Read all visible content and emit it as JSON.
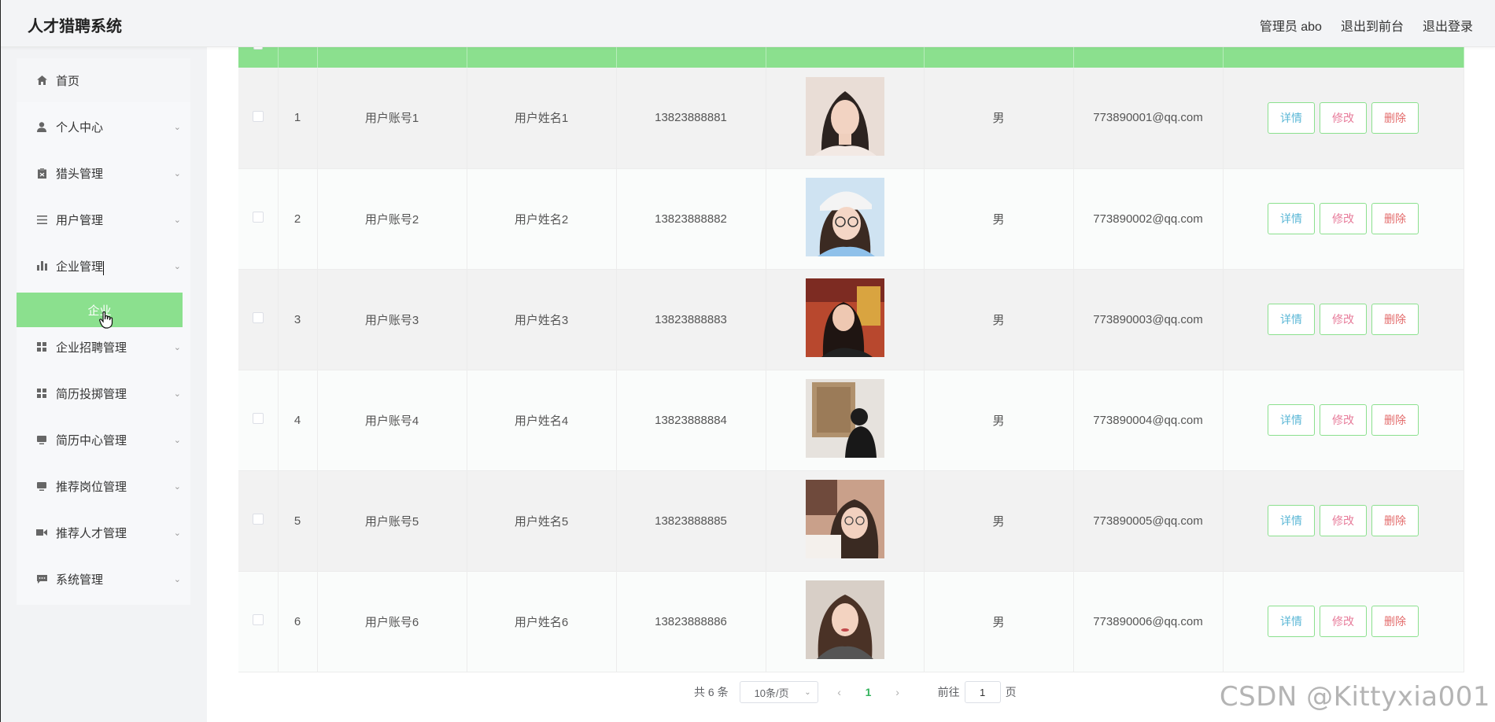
{
  "header": {
    "title": "人才猎聘系统",
    "links": [
      "管理员 abo",
      "退出到前台",
      "退出登录"
    ]
  },
  "sidebar": {
    "items": [
      {
        "label": "首页",
        "icon": "home-icon"
      },
      {
        "label": "个人中心",
        "icon": "user-icon"
      },
      {
        "label": "猎头管理",
        "icon": "clipboard-icon"
      },
      {
        "label": "用户管理",
        "icon": "list-icon"
      },
      {
        "label": "企业管理",
        "icon": "bar-chart-icon"
      },
      {
        "label": "企业招聘管理",
        "icon": "grid-icon"
      },
      {
        "label": "简历投掷管理",
        "icon": "grid-icon"
      },
      {
        "label": "简历中心管理",
        "icon": "monitor-icon"
      },
      {
        "label": "推荐岗位管理",
        "icon": "monitor-icon"
      },
      {
        "label": "推荐人才管理",
        "icon": "video-icon"
      },
      {
        "label": "系统管理",
        "icon": "message-icon"
      }
    ],
    "active_sub": "企业"
  },
  "table": {
    "rows": [
      {
        "index": "1",
        "account": "用户账号1",
        "name": "用户姓名1",
        "phone": "13823888881",
        "gender": "男",
        "email": "773890001@qq.com"
      },
      {
        "index": "2",
        "account": "用户账号2",
        "name": "用户姓名2",
        "phone": "13823888882",
        "gender": "男",
        "email": "773890002@qq.com"
      },
      {
        "index": "3",
        "account": "用户账号3",
        "name": "用户姓名3",
        "phone": "13823888883",
        "gender": "男",
        "email": "773890003@qq.com"
      },
      {
        "index": "4",
        "account": "用户账号4",
        "name": "用户姓名4",
        "phone": "13823888884",
        "gender": "男",
        "email": "773890004@qq.com"
      },
      {
        "index": "5",
        "account": "用户账号5",
        "name": "用户姓名5",
        "phone": "13823888885",
        "gender": "男",
        "email": "773890005@qq.com"
      },
      {
        "index": "6",
        "account": "用户账号6",
        "name": "用户姓名6",
        "phone": "13823888886",
        "gender": "男",
        "email": "773890006@qq.com"
      }
    ],
    "buttons": {
      "detail": "详情",
      "edit": "修改",
      "delete": "删除"
    }
  },
  "pagination": {
    "total": "共 6 条",
    "page_size": "10条/页",
    "current": "1",
    "goto_prefix": "前往",
    "goto_value": "1",
    "goto_suffix": "页"
  },
  "watermark": "CSDN @Kittyxia001",
  "colors": {
    "accent": "#8be08e",
    "header_bg": "#f3f4f6",
    "sidebar_bg": "#f2f3f5"
  }
}
